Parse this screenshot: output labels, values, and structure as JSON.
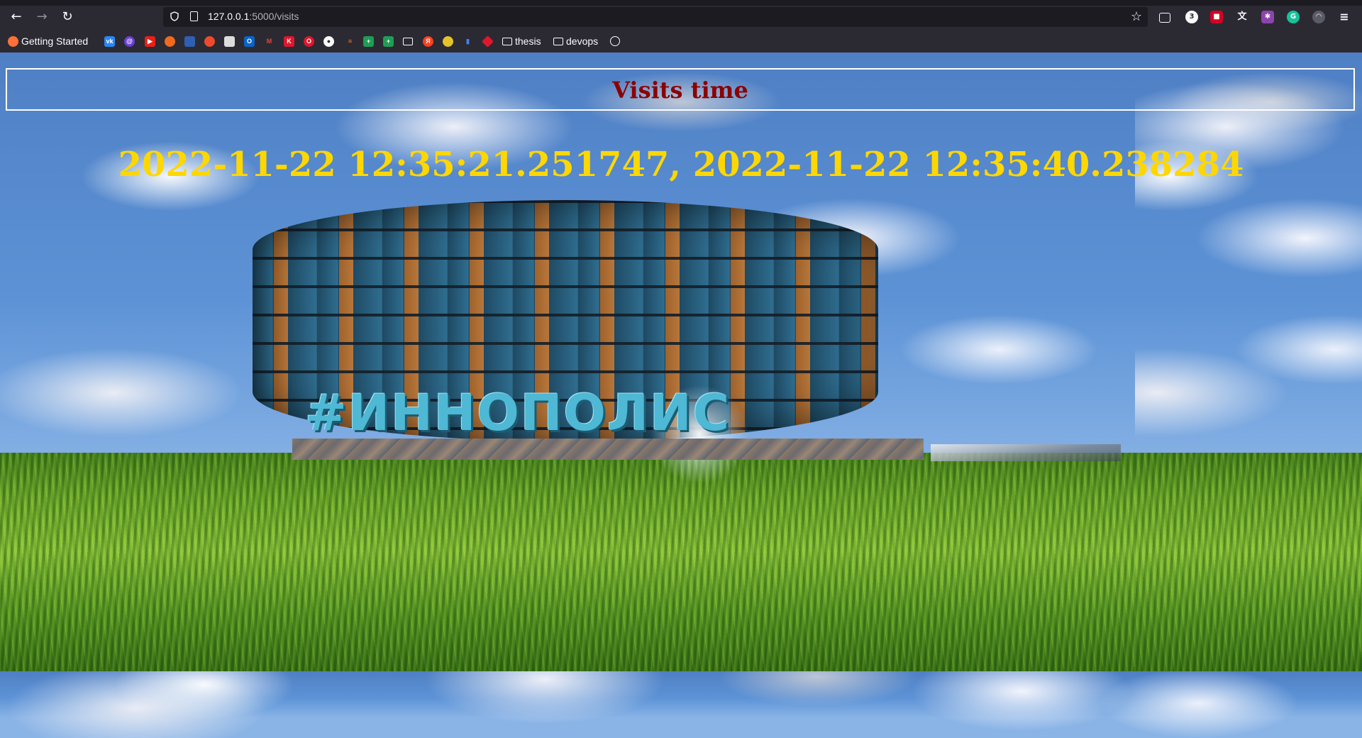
{
  "browser": {
    "url_host": "127.0.0.1",
    "url_path": ":5000/visits",
    "toolbar_badge": "3",
    "bookmarks": [
      {
        "label": "Getting Started",
        "icon": "firefox-icon"
      },
      {
        "label": "thesis",
        "icon": "folder-icon"
      },
      {
        "label": "devops",
        "icon": "folder-icon"
      }
    ]
  },
  "page": {
    "title": "Visits time",
    "visits": "2022-11-22 12:35:21.251747, 2022-11-22 12:35:40.238284",
    "sign": "#ИННОПОЛИС"
  },
  "colors": {
    "title": "#8b0000",
    "visits": "#ffd700",
    "title_border": "#ffffff"
  }
}
